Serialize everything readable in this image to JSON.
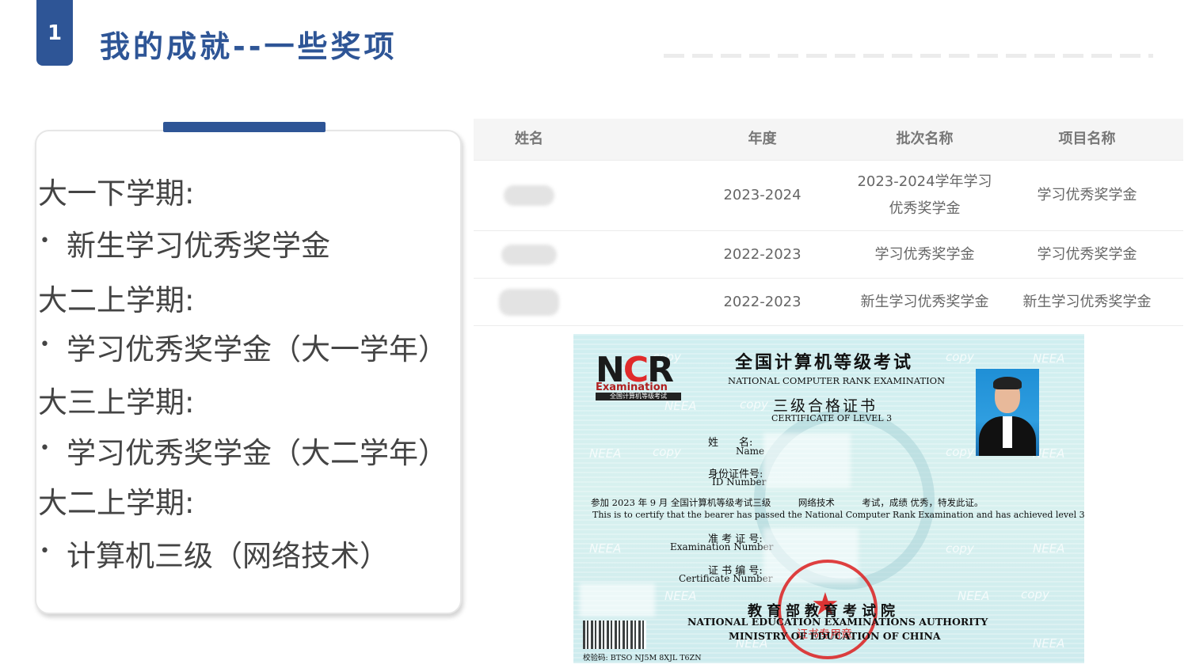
{
  "header": {
    "number": "1",
    "title": "我的成就--一些奖项"
  },
  "card": {
    "lines": [
      {
        "type": "term",
        "text": "大一下学期:"
      },
      {
        "type": "item",
        "text": "新生学习优秀奖学金"
      },
      {
        "type": "term",
        "text": "大二上学期:"
      },
      {
        "type": "item",
        "text": "学习优秀奖学金（大一学年）"
      },
      {
        "type": "term",
        "text": "大三上学期:"
      },
      {
        "type": "item",
        "text": "学习优秀奖学金（大二学年）"
      },
      {
        "type": "term",
        "text": "大二上学期:"
      },
      {
        "type": "item",
        "text": "计算机三级（网络技术）"
      }
    ],
    "bullet": "•"
  },
  "table": {
    "headers": [
      "姓名",
      "年度",
      "批次名称",
      "项目名称"
    ],
    "rows": [
      {
        "year": "2023-2024",
        "batch": "2023-2024学年学习\n优秀奖学金",
        "project": "学习优秀奖学金"
      },
      {
        "year": "2022-2023",
        "batch": "学习优秀奖学金",
        "project": "学习优秀奖学金"
      },
      {
        "year": "2022-2023",
        "batch": "新生学习优秀奖学金",
        "project": "新生学习优秀奖学金"
      }
    ]
  },
  "certificate": {
    "logo_main": "NCR",
    "logo_sub": "Examination",
    "logo_bar": "全国计算机等级考试",
    "title_cn": "全国计算机等级考试",
    "title_en": "NATIONAL COMPUTER RANK EXAMINATION",
    "level_cn": "三级合格证书",
    "level_en": "CERTIFICATE OF LEVEL 3",
    "name_cn": "姓　　名:",
    "name_en": "Name",
    "id_cn": "身份证件号:",
    "id_en": "ID Number",
    "statement_cn": "参加 2023 年 9 月 全国计算机等级考试三级　　　网络技术　　　考试，成绩 优秀，特发此证。",
    "statement_en": "This is to certify that the bearer has passed the National Computer Rank Examination and has achieved level 3.",
    "exam_no_cn": "准 考 证 号:",
    "exam_no_en": "Examination Number",
    "cert_no_cn": "证 书 编 号:",
    "cert_no_en": "Certificate Number",
    "issuer_cn": "教育部教育考试院",
    "issuer_en1": "NATIONAL EDUCATION EXAMINATIONS AUTHORITY",
    "issuer_en2": "MINISTRY OF EDUCATION OF CHINA",
    "check_code": "校验码: BTSO NJ5M 8XJL T6ZN",
    "seal_text": "证书专用章",
    "watermarks": [
      "NEEA",
      "copy"
    ]
  }
}
